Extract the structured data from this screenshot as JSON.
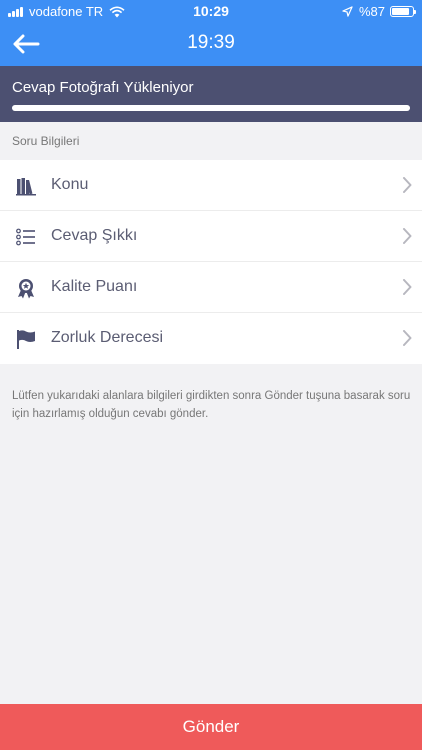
{
  "status_bar": {
    "carrier": "vodafone TR",
    "time": "10:29",
    "battery": "%87",
    "battery_level": 0.87
  },
  "nav": {
    "title": "19:39"
  },
  "upload": {
    "label": "Cevap Fotoğrafı Yükleniyor",
    "progress": 1.0
  },
  "section": {
    "header": "Soru Bilgileri"
  },
  "rows": [
    {
      "label": "Konu",
      "icon": "books-icon"
    },
    {
      "label": "Cevap Şıkkı",
      "icon": "list-icon"
    },
    {
      "label": "Kalite Puanı",
      "icon": "award-icon"
    },
    {
      "label": "Zorluk Derecesi",
      "icon": "flag-icon"
    }
  ],
  "help_text": "Lütfen yukarıdaki alanlara bilgileri girdikten sonra Gönder tuşuna basarak soru için hazırlamış olduğun cevabı gönder.",
  "send_button": {
    "label": "Gönder"
  },
  "colors": {
    "header_bg": "#3d8ff5",
    "banner_bg": "#4c5071",
    "send_bg": "#ef5a5a",
    "icon": "#4c5071"
  }
}
